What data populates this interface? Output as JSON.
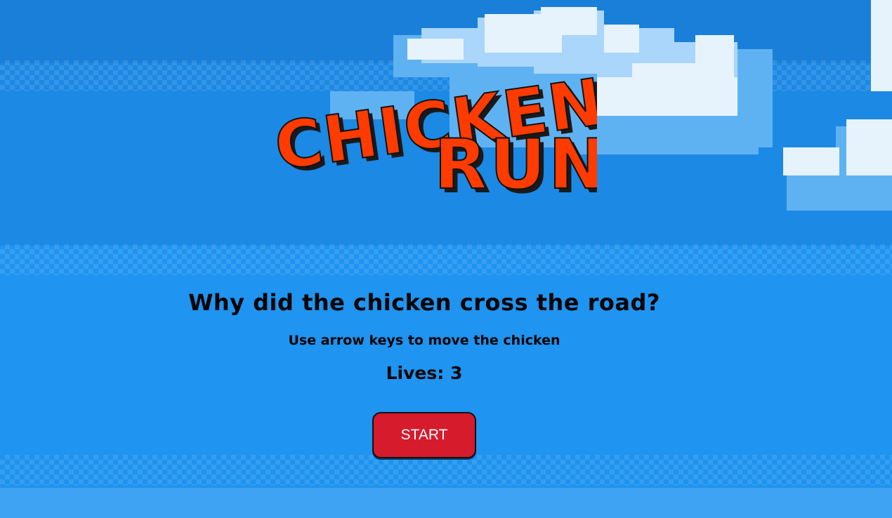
{
  "logo": {
    "line1": "CHICKEN",
    "line2": "RUN",
    "color": "#ff3b00"
  },
  "heading": "Why did the chicken cross the road?",
  "instructions": "Use arrow keys to move the chicken",
  "lives_text": "Lives: 3",
  "lives": 3,
  "start_button": {
    "label": "START",
    "color": "#d51b2c"
  },
  "sky_color": "#1e93ee"
}
